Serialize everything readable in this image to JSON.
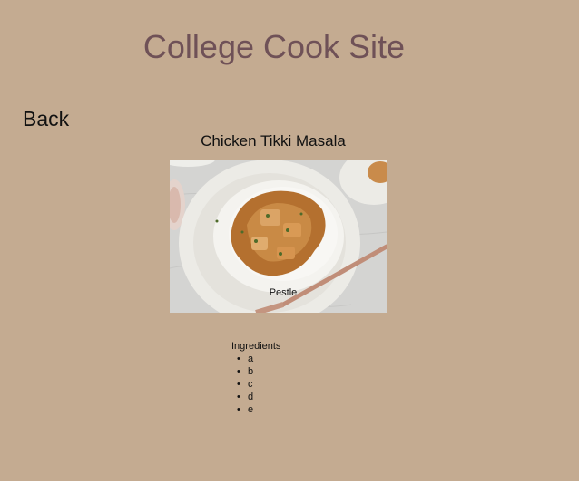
{
  "site": {
    "title": "College Cook Site"
  },
  "nav": {
    "back_label": "Back"
  },
  "recipe": {
    "title": "Chicken Tikki Masala",
    "photo_caption": "Pestle",
    "ingredients_heading": "Ingredients",
    "ingredients": [
      "a",
      "b",
      "c",
      "d",
      "e"
    ]
  },
  "colors": {
    "page_background": "#c4ab91",
    "title_color": "#6f5157"
  }
}
